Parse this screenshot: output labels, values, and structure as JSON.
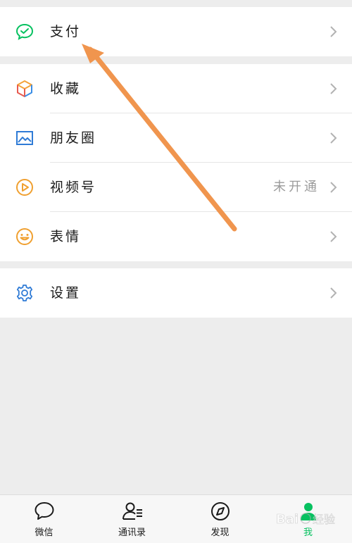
{
  "menu": {
    "pay": {
      "label": "支付",
      "icon": "wechat-pay-icon"
    },
    "favorites": {
      "label": "收藏",
      "icon": "cube-icon"
    },
    "moments": {
      "label": "朋友圈",
      "icon": "photo-icon"
    },
    "channels": {
      "label": "视频号",
      "value": "未开通",
      "icon": "play-circle-icon"
    },
    "stickers": {
      "label": "表情",
      "icon": "smiley-icon"
    },
    "settings": {
      "label": "设置",
      "icon": "gear-icon"
    }
  },
  "tabbar": {
    "items": [
      {
        "label": "微信",
        "icon": "chat-bubble-icon"
      },
      {
        "label": "通讯录",
        "icon": "contacts-icon"
      },
      {
        "label": "发现",
        "icon": "compass-icon"
      },
      {
        "label": "我",
        "icon": "person-icon",
        "active": true
      }
    ]
  },
  "watermark": {
    "text": "Baidu经验"
  },
  "colors": {
    "accent": "#07c160",
    "annotation_arrow": "#f0954e",
    "background": "#ededed"
  }
}
